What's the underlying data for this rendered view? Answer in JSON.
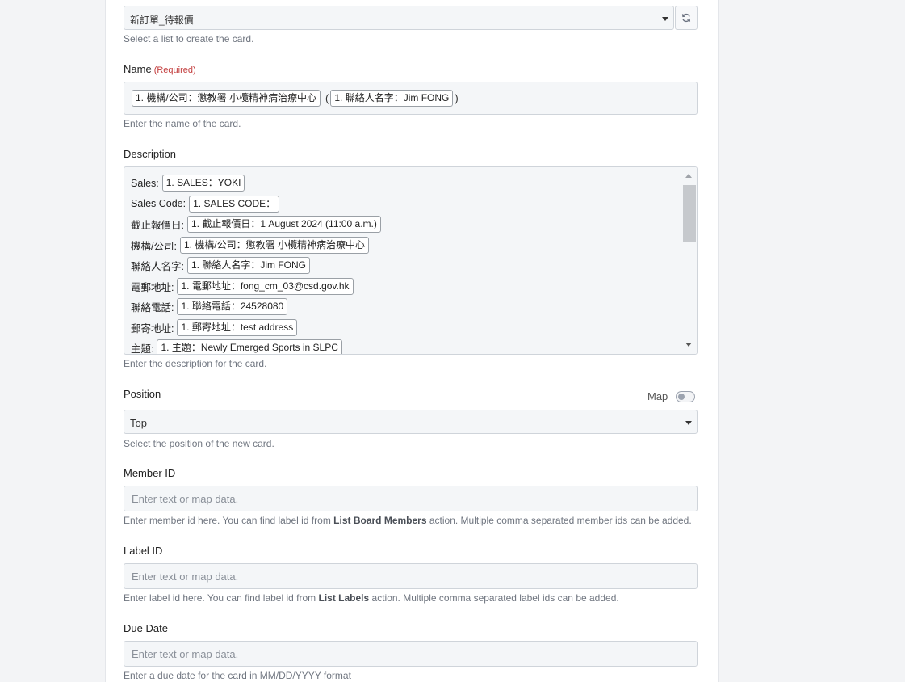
{
  "list": {
    "selected": "新訂單_待報價",
    "help": "Select a list to create the card."
  },
  "name": {
    "label": "Name",
    "required": "(Required)",
    "open_paren": "(",
    "pill_1": "1. 機構/公司：懲教署 小欖精神病治療中心",
    "pill_2": "1. 聯絡人名字：Jim FONG",
    "close_paren": ")",
    "help": "Enter the name of the card."
  },
  "description": {
    "label": "Description",
    "rows": [
      {
        "key": "Sales:",
        "value": "1. SALES：YOKI"
      },
      {
        "key": "Sales Code:",
        "value": "1. SALES CODE："
      },
      {
        "key": "截止報價日:",
        "value": "1. 截止報價日：1 August 2024 (11:00 a.m.)"
      },
      {
        "key": "機構/公司:",
        "value": "1. 機構/公司：懲教署 小欖精神病治療中心"
      },
      {
        "key": "聯絡人名字:",
        "value": "1. 聯絡人名字：Jim FONG"
      },
      {
        "key": "電郵地址:",
        "value": "1. 電郵地址：fong_cm_03@csd.gov.hk"
      },
      {
        "key": "聯絡電話:",
        "value": "1. 聯絡電話：24528080"
      },
      {
        "key": "郵寄地址:",
        "value": "1. 郵寄地址：test address"
      },
      {
        "key": "主題:",
        "value": "1. 主題：Newly Emerged Sports in SLPC"
      }
    ],
    "help": "Enter the description for the card."
  },
  "position": {
    "label": "Position",
    "map_label": "Map",
    "selected": "Top",
    "help": "Select the position of the new card."
  },
  "member_id": {
    "label": "Member ID",
    "placeholder": "Enter text or map data.",
    "help_pre": "Enter member id here. You can find label id from ",
    "help_bold": "List Board Members",
    "help_post": " action. Multiple comma separated member ids can be added."
  },
  "label_id": {
    "label": "Label ID",
    "placeholder": "Enter text or map data.",
    "help_pre": "Enter label id here. You can find label id from ",
    "help_bold": "List Labels",
    "help_post": " action. Multiple comma separated label ids can be added."
  },
  "due_date": {
    "label": "Due Date",
    "placeholder": "Enter text or map data.",
    "help": "Enter a due date for the card in MM/DD/YYYY format"
  }
}
